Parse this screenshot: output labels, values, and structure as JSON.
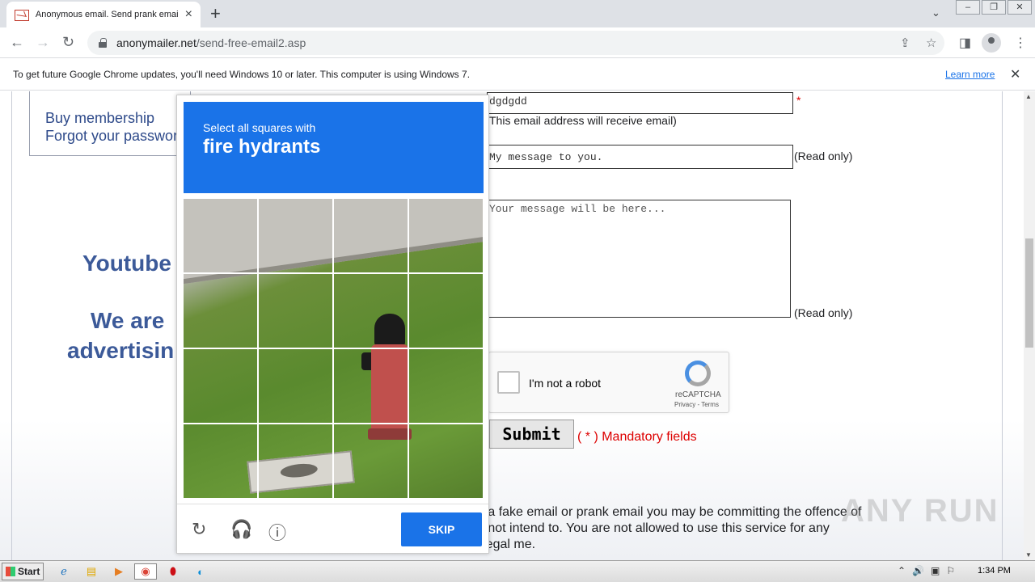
{
  "browser": {
    "tab_title": "Anonymous email. Send prank email.",
    "new_tab": "+",
    "url_host": "anonymailer.net",
    "url_path": "/send-free-email2.asp"
  },
  "infobar": {
    "message": "To get future Google Chrome updates, you'll need Windows 10 or later. This computer is using Windows 7.",
    "link": "Learn more"
  },
  "sidebar": {
    "buy_membership": "Buy membership",
    "forgot_password": "Forgot your passwor",
    "promo_1": "Youtube",
    "promo_2": "We are",
    "promo_3": "advertisin"
  },
  "form": {
    "to_value": "dgdgdd",
    "to_star": "*",
    "to_note": "This email address will receive email)",
    "subject_value": "My message to you.",
    "subject_note": "(Read only)",
    "message_placeholder": "Your message will be here...",
    "message_note": "(Read only)",
    "submit_label": "Submit",
    "mandatory_label": "( * ) Mandatory  fields",
    "warning_text": "g a fake email or prank email you may be committing the offence of d not intend to. You are not allowed to use this service for any illegal me."
  },
  "recaptcha": {
    "label": "I'm not a robot",
    "brand": "reCAPTCHA",
    "terms": "Privacy - Terms"
  },
  "challenge": {
    "instruction": "Select all squares with",
    "target": "fire hydrants",
    "skip_label": "SKIP",
    "grid_size": 4
  },
  "watermark": "ANY RUN",
  "taskbar": {
    "start_label": "Start",
    "time": "1:34 PM"
  }
}
